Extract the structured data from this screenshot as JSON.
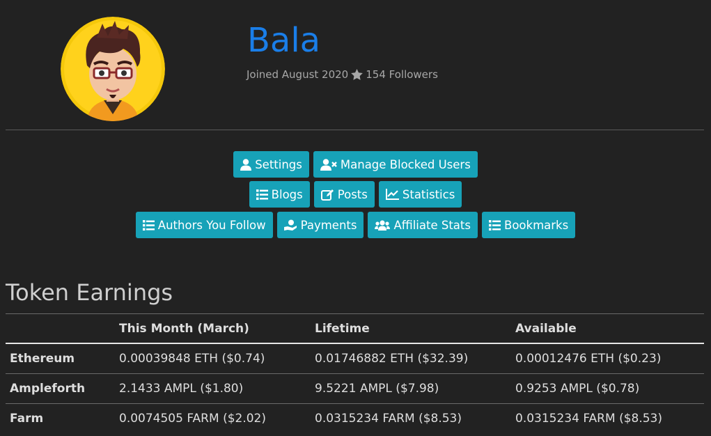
{
  "profile": {
    "name": "Bala",
    "joined": "Joined August 2020",
    "followers": "154 Followers",
    "icons": {
      "joined_separator": "star-icon"
    }
  },
  "colors": {
    "background": "#222222",
    "name": "#1a7ee8",
    "button": "#17a2b8",
    "meta_text": "#a8a8a8"
  },
  "buttons": {
    "row1": [
      {
        "label": "Settings",
        "icon": "user-icon"
      },
      {
        "label": "Manage Blocked Users",
        "icon": "user-block-icon"
      }
    ],
    "row2": [
      {
        "label": "Blogs",
        "icon": "list-icon"
      },
      {
        "label": "Posts",
        "icon": "edit-icon"
      },
      {
        "label": "Statistics",
        "icon": "chart-icon"
      }
    ],
    "row3": [
      {
        "label": "Authors You Follow",
        "icon": "list-icon"
      },
      {
        "label": "Payments",
        "icon": "hand-holding-dollar-icon"
      },
      {
        "label": "Affiliate Stats",
        "icon": "users-icon"
      },
      {
        "label": "Bookmarks",
        "icon": "list-icon"
      }
    ]
  },
  "earnings": {
    "title": "Token Earnings",
    "columns": [
      "",
      "This Month (March)",
      "Lifetime",
      "Available"
    ],
    "rows": [
      {
        "token": "Ethereum",
        "month": "0.00039848 ETH ($0.74)",
        "lifetime": "0.01746882 ETH ($32.39)",
        "available": "0.00012476 ETH ($0.23)"
      },
      {
        "token": "Ampleforth",
        "month": "2.1433 AMPL ($1.80)",
        "lifetime": "9.5221 AMPL ($7.98)",
        "available": "0.9253 AMPL ($0.78)"
      },
      {
        "token": "Farm",
        "month": "0.0074505 FARM ($2.02)",
        "lifetime": "0.0315234 FARM ($8.53)",
        "available": "0.0315234 FARM ($8.53)"
      }
    ]
  }
}
